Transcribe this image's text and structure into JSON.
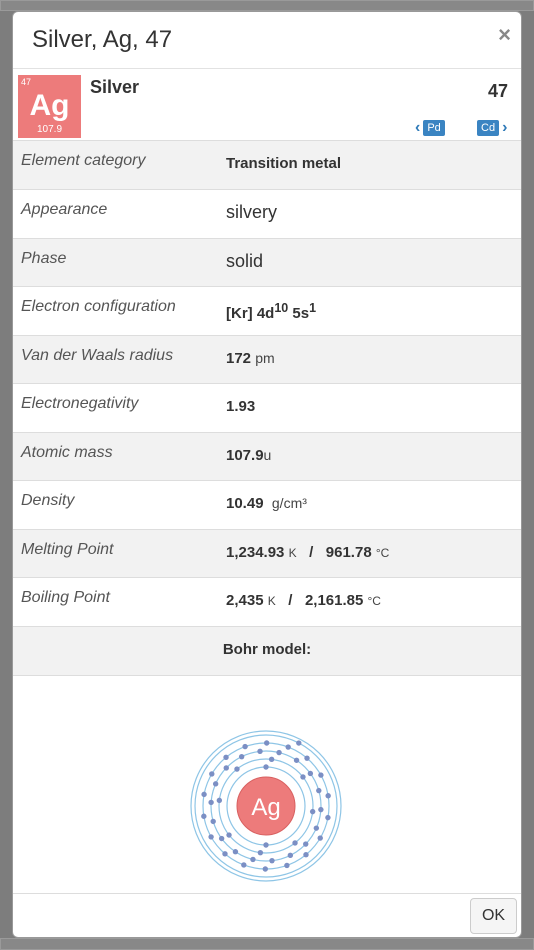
{
  "modal": {
    "title": "Silver, Ag, 47",
    "close_glyph": "×",
    "ok_label": "OK"
  },
  "element": {
    "number": "47",
    "symbol": "Ag",
    "mass": "107.9",
    "name": "Silver",
    "tile_color": "#ed7b7b"
  },
  "nav": {
    "prev_label": "Pd",
    "next_label": "Cd",
    "prev_icon": "chevron-left-icon",
    "next_icon": "chevron-right-icon"
  },
  "properties": [
    {
      "label": "Element category",
      "value": "Transition metal"
    },
    {
      "label": "Appearance",
      "value": "silvery"
    },
    {
      "label": "Phase",
      "value": "solid"
    },
    {
      "label": "Electron configuration",
      "value": "[Kr] 4d",
      "sup1": "10",
      "mid": " 5s",
      "sup2": "1"
    },
    {
      "label": "Van der Waals radius",
      "value": "172",
      "unit": "pm"
    },
    {
      "label": "Electronegativity",
      "value": "1.93"
    },
    {
      "label": "Atomic mass",
      "value": "107.9",
      "unit": "u"
    },
    {
      "label": "Density",
      "value": "10.49",
      "unit": "g/cm³"
    },
    {
      "label": "Melting Point",
      "value": "1,234.93",
      "unit": "K",
      "sep": "/",
      "value2": "961.78",
      "unit2": "°C"
    },
    {
      "label": "Boiling Point",
      "value": "2,435",
      "unit": "K",
      "sep": "/",
      "value2": "2,161.85",
      "unit2": "°C"
    }
  ],
  "bohr": {
    "heading": "Bohr model:",
    "shells": [
      2,
      8,
      18,
      18,
      1
    ],
    "nucleus_color": "#ed7b7b",
    "orbit_color": "#8ec5e6",
    "electron_color": "#7b8fc4"
  }
}
